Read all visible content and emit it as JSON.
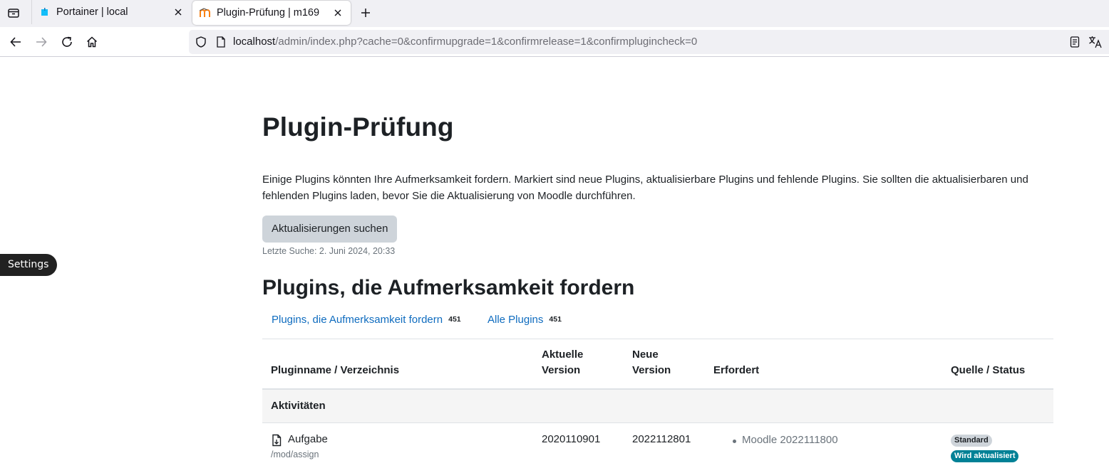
{
  "browser": {
    "tabs": [
      {
        "title": "Portainer | local",
        "favicon": "portainer-icon",
        "active": false
      },
      {
        "title": "Plugin-Prüfung | m169",
        "favicon": "moodle-icon",
        "active": true
      }
    ],
    "url": {
      "host": "localhost",
      "path": "/admin/index.php?cache=0&confirmupgrade=1&confirmrelease=1&confirmplugincheck=0"
    },
    "icons": [
      "tab-list-icon",
      "close-icon",
      "plus-icon",
      "back-icon",
      "forward-icon",
      "reload-icon",
      "home-icon",
      "shield-icon",
      "page-icon",
      "reader-view-icon",
      "translate-icon"
    ]
  },
  "page": {
    "settings_label": "Settings",
    "title": "Plugin-Prüfung",
    "intro": "Einige Plugins könnten Ihre Aufmerksamkeit fordern. Markiert sind neue Plugins, aktualisierbare Plugins und fehlende Plugins. Sie sollten die aktualisierbaren und fehlenden Plugins laden, bevor Sie die Aktualisierung von Moodle durchführen.",
    "check_button": "Aktualisierungen suchen",
    "last_check": "Letzte Suche: 2. Juni 2024, 20:33",
    "section_title": "Plugins, die Aufmerksamkeit fordern",
    "filters": [
      {
        "label": "Plugins, die Aufmerksamkeit fordern",
        "count": "451"
      },
      {
        "label": "Alle Plugins",
        "count": "451"
      }
    ],
    "table": {
      "headers": {
        "name": "Pluginname / Verzeichnis",
        "current_line1": "Aktuelle",
        "current_line2": "Version",
        "new_line1": "Neue",
        "new_line2": "Version",
        "required": "Erfordert",
        "source": "Quelle / Status"
      },
      "group": "Aktivitäten",
      "rows": [
        {
          "name": "Aufgabe",
          "dir": "/mod/assign",
          "current": "2020110901",
          "new": "2022112801",
          "requires": "Moodle 2022111800",
          "source": "Standard",
          "status": "Wird aktualisiert"
        }
      ]
    }
  }
}
